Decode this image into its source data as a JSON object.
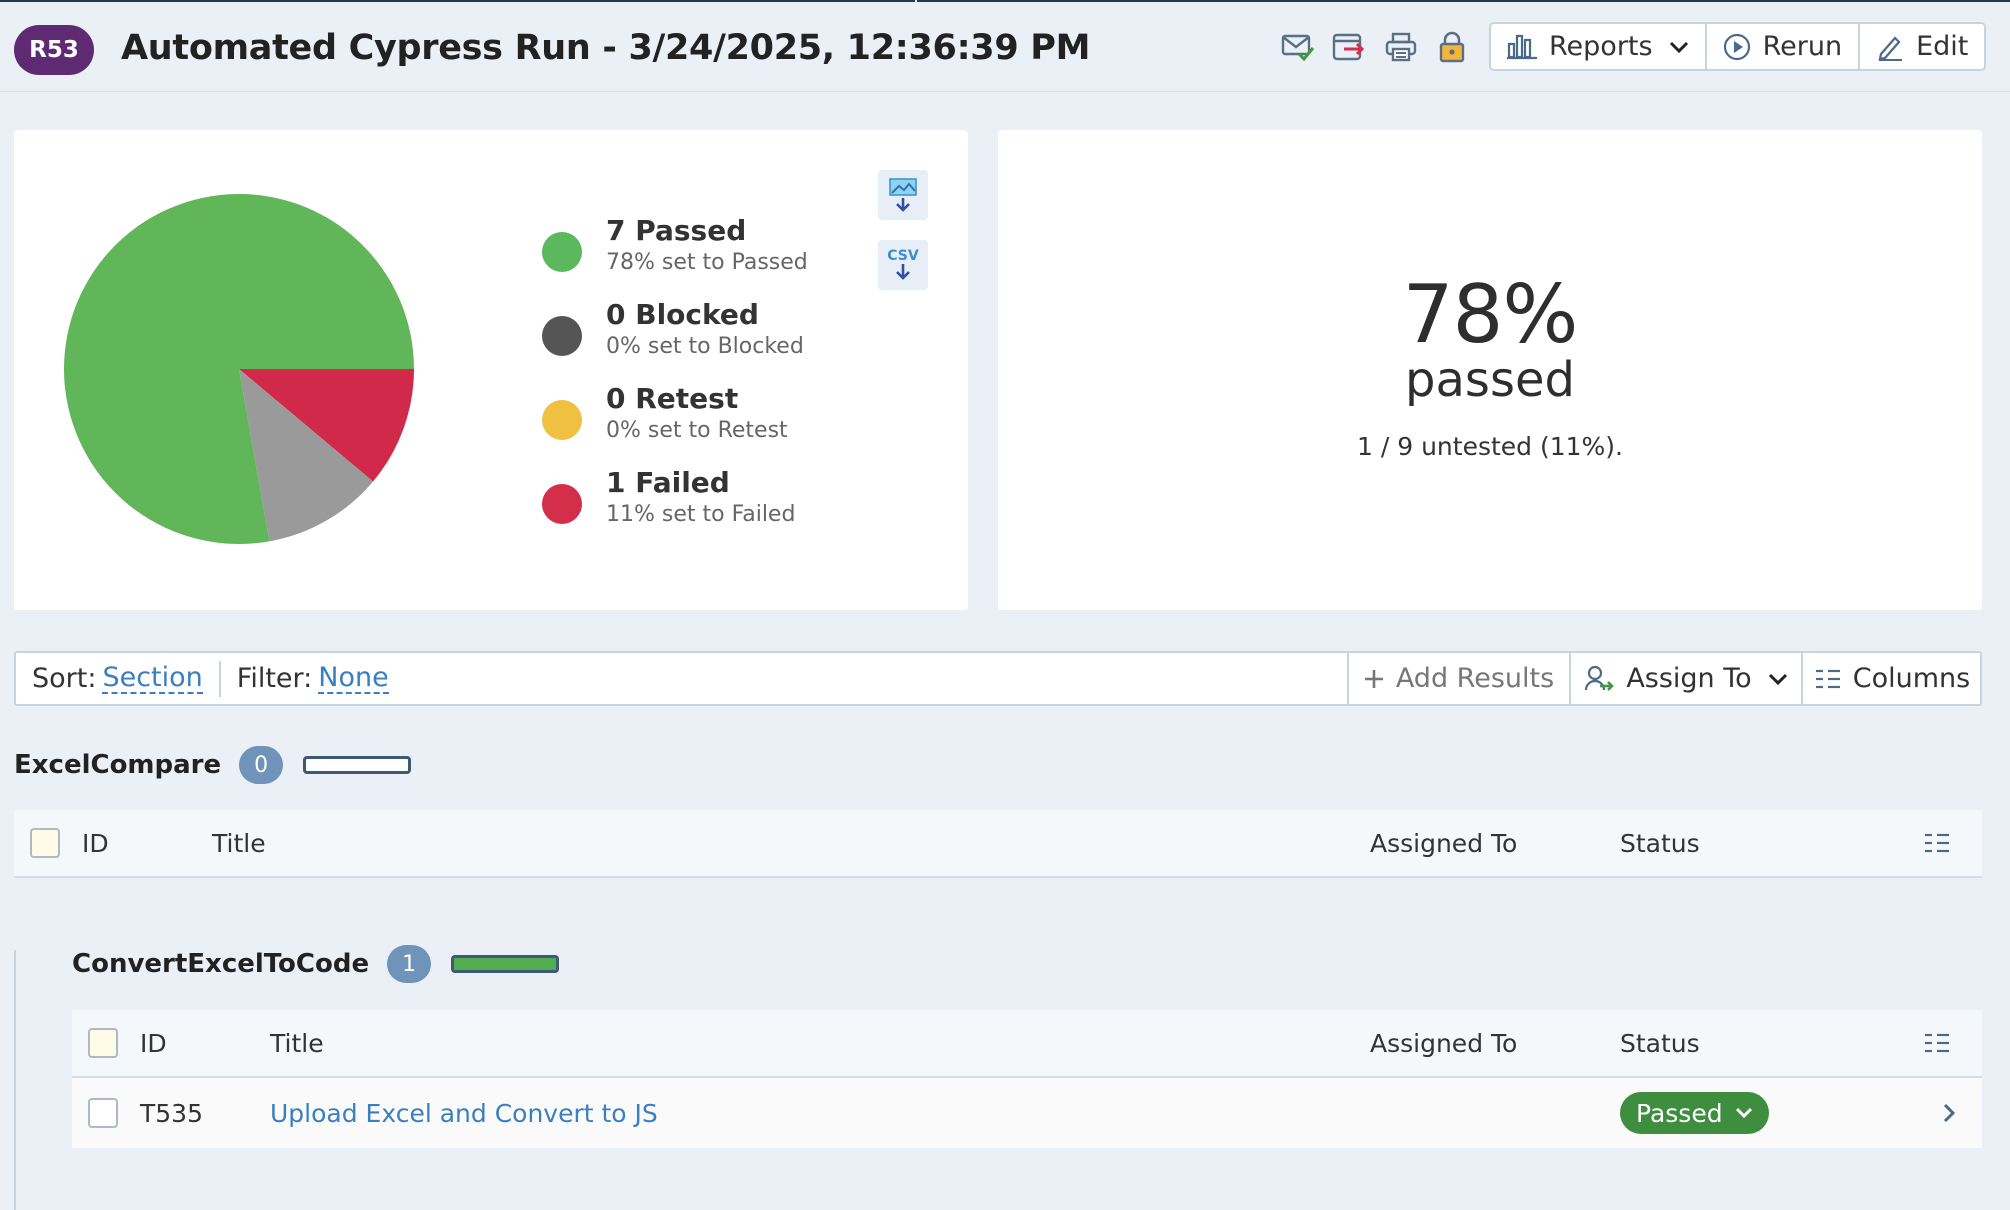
{
  "header": {
    "run_id": "R53",
    "title": "Automated Cypress Run - 3/24/2025, 12:36:39 PM",
    "icons": [
      "email-check-icon",
      "export-icon",
      "print-icon",
      "lock-icon"
    ],
    "buttons": {
      "reports": "Reports",
      "rerun": "Rerun",
      "edit": "Edit"
    }
  },
  "chart": {
    "legend": [
      {
        "title": "7 Passed",
        "sub": "78% set to Passed",
        "color": "#5cb85c"
      },
      {
        "title": "0 Blocked",
        "sub": "0% set to Blocked",
        "color": "#555555"
      },
      {
        "title": "0 Retest",
        "sub": "0% set to Retest",
        "color": "#f0c040"
      },
      {
        "title": "1 Failed",
        "sub": "11% set to Failed",
        "color": "#d32f4a"
      }
    ],
    "download_csv_label": "CSV"
  },
  "chart_data": {
    "type": "pie",
    "categories": [
      "Passed",
      "Untested",
      "Failed",
      "Blocked",
      "Retest"
    ],
    "values": [
      7,
      1,
      1,
      0,
      0
    ],
    "colors": [
      "#61b65a",
      "#9a9a9a",
      "#d1294a",
      "#555555",
      "#f0c040"
    ]
  },
  "summary": {
    "percent": "78%",
    "label": "passed",
    "untested": "1 / 9 untested (11%)."
  },
  "toolbar": {
    "sort_label": "Sort:",
    "sort_value": "Section",
    "filter_label": "Filter:",
    "filter_value": "None",
    "add_results": "Add Results",
    "assign_to": "Assign To",
    "columns": "Columns"
  },
  "sections": [
    {
      "name": "ExcelCompare",
      "count": "0",
      "progress": 0,
      "columns": {
        "id": "ID",
        "title": "Title",
        "assigned_to": "Assigned To",
        "status": "Status"
      },
      "rows": []
    },
    {
      "name": "ConvertExcelToCode",
      "count": "1",
      "progress": 1,
      "columns": {
        "id": "ID",
        "title": "Title",
        "assigned_to": "Assigned To",
        "status": "Status"
      },
      "rows": [
        {
          "id": "T535",
          "title": "Upload Excel and Convert to JS",
          "assigned_to": "",
          "status": "Passed"
        }
      ]
    }
  ]
}
